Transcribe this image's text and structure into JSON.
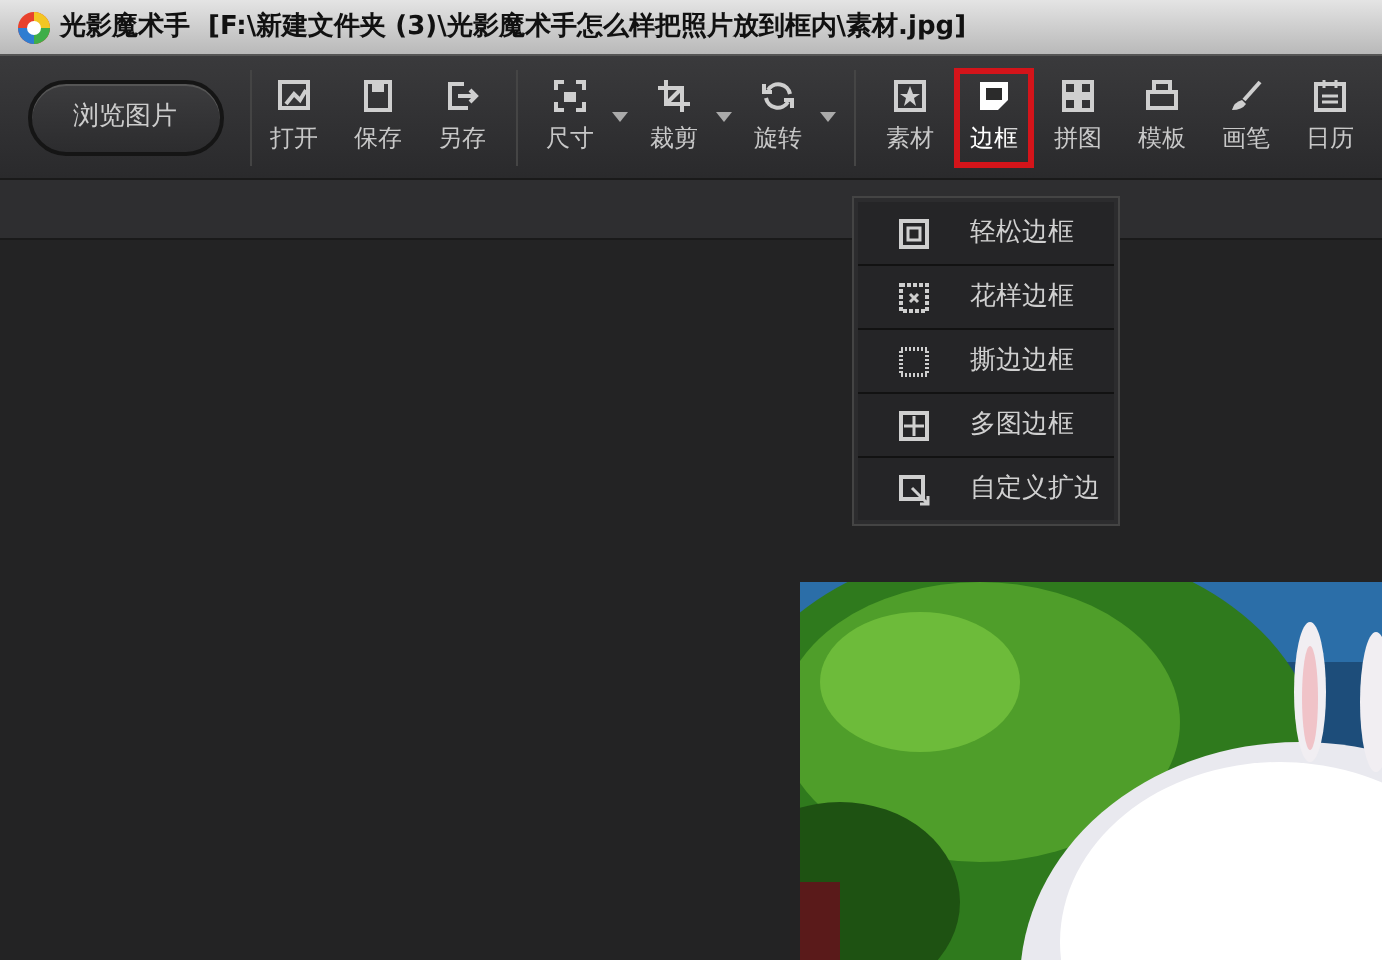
{
  "window": {
    "title": "光影魔术手  [F:\\新建文件夹 (3)\\光影魔术手怎么样把照片放到框内\\素材.jpg]"
  },
  "browse_button": {
    "label": "浏览图片"
  },
  "toolbar": [
    {
      "label": "打开",
      "has_dropdown": false,
      "selected": false,
      "separator_before": false
    },
    {
      "label": "保存",
      "has_dropdown": false,
      "selected": false,
      "separator_before": false
    },
    {
      "label": "另存",
      "has_dropdown": false,
      "selected": false,
      "separator_before": false
    },
    {
      "label": "尺寸",
      "has_dropdown": true,
      "selected": false,
      "separator_before": true
    },
    {
      "label": "裁剪",
      "has_dropdown": true,
      "selected": false,
      "separator_before": false
    },
    {
      "label": "旋转",
      "has_dropdown": true,
      "selected": false,
      "separator_before": false
    },
    {
      "label": "素材",
      "has_dropdown": false,
      "selected": false,
      "separator_before": true
    },
    {
      "label": "边框",
      "has_dropdown": false,
      "selected": true,
      "separator_before": false
    },
    {
      "label": "拼图",
      "has_dropdown": false,
      "selected": false,
      "separator_before": false
    },
    {
      "label": "模板",
      "has_dropdown": false,
      "selected": false,
      "separator_before": false
    },
    {
      "label": "画笔",
      "has_dropdown": false,
      "selected": false,
      "separator_before": false
    },
    {
      "label": "日历",
      "has_dropdown": false,
      "selected": false,
      "separator_before": false
    }
  ],
  "border_menu": [
    {
      "label": "轻松边框"
    },
    {
      "label": "花样边框"
    },
    {
      "label": "撕边边框"
    },
    {
      "label": "多图边框"
    },
    {
      "label": "自定义扩边"
    }
  ]
}
